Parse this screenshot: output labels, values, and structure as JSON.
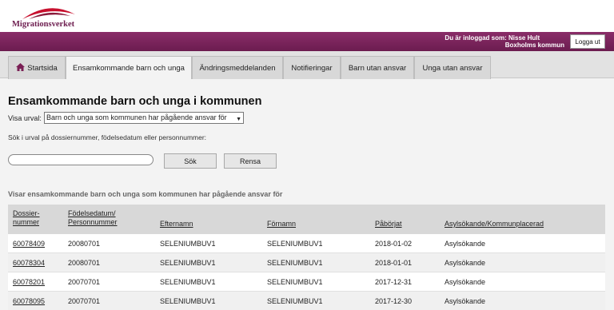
{
  "brand": {
    "name": "Migrationsverket",
    "color": "#6d1d4f"
  },
  "user": {
    "logged_in_label": "Du är inloggad som:",
    "name": "Nisse Hult",
    "municipality": "Boxholms kommun",
    "logout_label": "Logga ut"
  },
  "tabs": [
    {
      "label": "Startsida",
      "icon": "home-icon"
    },
    {
      "label": "Ensamkommande barn och unga",
      "active": true
    },
    {
      "label": "Ändringsmeddelanden"
    },
    {
      "label": "Notifieringar"
    },
    {
      "label": "Barn utan ansvar"
    },
    {
      "label": "Unga utan ansvar"
    }
  ],
  "page": {
    "title": "Ensamkommande barn och unga i kommunen",
    "filter_label": "Visa urval:",
    "filter_selected": "Barn och unga som kommunen har pågående ansvar för",
    "search_label": "Sök i urval på dossiernummer, födelsedatum eller personnummer:",
    "search_value": "",
    "search_button": "Sök",
    "clear_button": "Rensa",
    "list_heading": "Visar ensamkommande barn och unga som kommunen har pågående ansvar för"
  },
  "table": {
    "columns": [
      {
        "line1": "Dossier-",
        "line2": "nummer"
      },
      {
        "line1": "Födelsedatum/",
        "line2": "Personnummer"
      },
      {
        "line1": "Efternamn",
        "line2": ""
      },
      {
        "line1": "Förnamn",
        "line2": ""
      },
      {
        "line1": "Påbörjat",
        "line2": ""
      },
      {
        "line1": "Asylsökande/Kommunplacerad",
        "line2": ""
      }
    ],
    "rows": [
      [
        "60078409",
        "20080701",
        "SELENIUMBUV1",
        "SELENIUMBUV1",
        "2018-01-02",
        "Asylsökande"
      ],
      [
        "60078304",
        "20080701",
        "SELENIUMBUV1",
        "SELENIUMBUV1",
        "2018-01-01",
        "Asylsökande"
      ],
      [
        "60078201",
        "20070701",
        "SELENIUMBUV1",
        "SELENIUMBUV1",
        "2017-12-31",
        "Asylsökande"
      ],
      [
        "60078095",
        "20070701",
        "SELENIUMBUV1",
        "SELENIUMBUV1",
        "2017-12-30",
        "Asylsökande"
      ]
    ]
  }
}
